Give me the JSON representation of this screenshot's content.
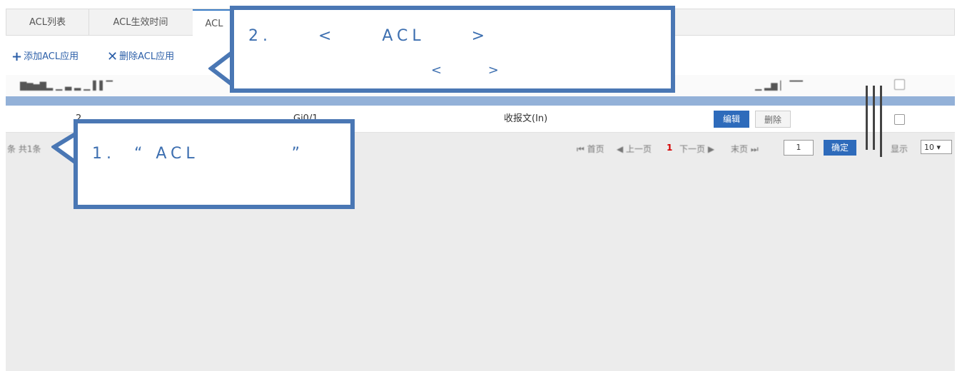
{
  "tabs": [
    {
      "label": "ACL列表"
    },
    {
      "label": "ACL生效时间"
    },
    {
      "label": "ACL"
    }
  ],
  "toolbar": {
    "add_label": "添加ACL应用",
    "delete_label": "删除ACL应用"
  },
  "table": {
    "row": {
      "index": "2",
      "interface": "Gi0/1",
      "direction": "收报文(In)",
      "edit_label": "编辑",
      "delete_label": "删除"
    }
  },
  "pager": {
    "summary": "条 共1条",
    "first": "首页",
    "prev": "上一页",
    "current": "1",
    "next": "下一页",
    "last": "末页",
    "page_input": "1",
    "confirm": "确定",
    "show": "显示",
    "per_page": "10"
  },
  "callouts": {
    "one": {
      "line1": "1.  “ ACL          ”"
    },
    "two": {
      "line1": "2.     <     ACL     >",
      "line2": "<     >"
    }
  },
  "colors": {
    "accent": "#2e6bbb",
    "callout_border": "#4a77b4",
    "band": "#93b1d8"
  }
}
